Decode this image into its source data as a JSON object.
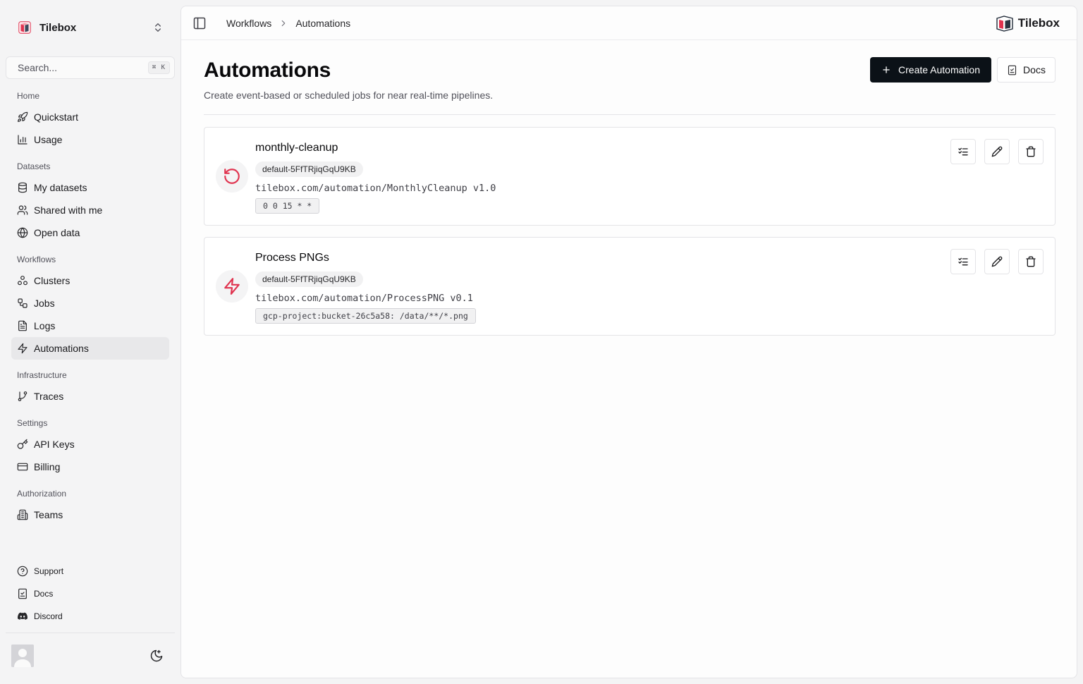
{
  "sidebar": {
    "org": {
      "name": "Tilebox",
      "logo_icon": "tilebox-logo-icon",
      "switch_icon": "chevrons-up-down-icon"
    },
    "search": {
      "placeholder": "Search...",
      "shortcut": "⌘ K"
    },
    "sections": [
      {
        "label": "Home",
        "items": [
          {
            "label": "Quickstart",
            "icon": "rocket-icon"
          },
          {
            "label": "Usage",
            "icon": "bar-chart-icon"
          }
        ]
      },
      {
        "label": "Datasets",
        "items": [
          {
            "label": "My datasets",
            "icon": "database-icon"
          },
          {
            "label": "Shared with me",
            "icon": "users-icon"
          },
          {
            "label": "Open data",
            "icon": "globe-icon"
          }
        ]
      },
      {
        "label": "Workflows",
        "items": [
          {
            "label": "Clusters",
            "icon": "boxes-icon"
          },
          {
            "label": "Jobs",
            "icon": "workflow-icon"
          },
          {
            "label": "Logs",
            "icon": "file-text-icon"
          },
          {
            "label": "Automations",
            "icon": "zap-icon",
            "active": true
          }
        ]
      },
      {
        "label": "Infrastructure",
        "items": [
          {
            "label": "Traces",
            "icon": "git-branch-icon"
          }
        ]
      },
      {
        "label": "Settings",
        "items": [
          {
            "label": "API Keys",
            "icon": "key-icon"
          },
          {
            "label": "Billing",
            "icon": "credit-card-icon"
          }
        ]
      },
      {
        "label": "Authorization",
        "items": [
          {
            "label": "Teams",
            "icon": "building-icon"
          }
        ]
      }
    ],
    "bottom_links": [
      {
        "label": "Support",
        "icon": "help-circle-icon"
      },
      {
        "label": "Docs",
        "icon": "book-check-icon"
      },
      {
        "label": "Discord",
        "icon": "discord-icon"
      }
    ]
  },
  "topbar": {
    "breadcrumb": [
      "Workflows",
      "Automations"
    ],
    "brand": "Tilebox"
  },
  "page": {
    "title": "Automations",
    "subtitle": "Create event-based or scheduled jobs for near real-time pipelines.",
    "create_button": "Create Automation",
    "docs_button": "Docs"
  },
  "automations": [
    {
      "name": "monthly-cleanup",
      "type_icon": "rotate-ccw-icon",
      "cluster": "default-5FfTRjiqGqU9KB",
      "identifier": "tilebox.com/automation/MonthlyCleanup v1.0",
      "trigger": "0 0 15 * *"
    },
    {
      "name": "Process PNGs",
      "type_icon": "zap-icon",
      "cluster": "default-5FfTRjiqGqU9KB",
      "identifier": "tilebox.com/automation/ProcessPNG v0.1",
      "trigger": "gcp-project:bucket-26c5a58: /data/**/*.png"
    }
  ],
  "colors": {
    "accent": "#e0334f",
    "primary_button": "#0b1117",
    "active_nav": "#e8e8ea"
  }
}
